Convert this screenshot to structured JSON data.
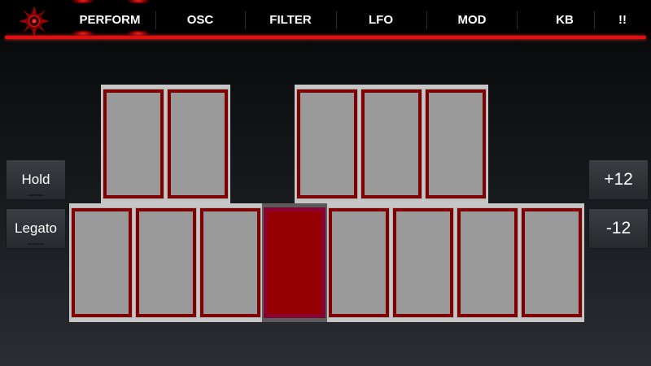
{
  "app": {
    "accent_color": "#e01010",
    "key_border_color": "#7e0000",
    "key_fill_color": "#9a9a9a",
    "pressed_key_color": "#950000"
  },
  "nav": {
    "logo_icon": "red-sun-logo-icon",
    "tabs": [
      {
        "label": "PERFORM",
        "selected": true
      },
      {
        "label": "OSC",
        "selected": false
      },
      {
        "label": "FILTER",
        "selected": false
      },
      {
        "label": "LFO",
        "selected": false
      },
      {
        "label": "MOD",
        "selected": false
      },
      {
        "label": "KB",
        "selected": false
      },
      {
        "label": "!!",
        "selected": false
      }
    ]
  },
  "left_controls": {
    "hold_label": "Hold",
    "legato_label": "Legato"
  },
  "right_controls": {
    "octave_up_label": "+12",
    "octave_down_label": "-12"
  },
  "keyboard": {
    "upper_left_keys": 2,
    "upper_right_keys": 3,
    "lower_keys": 8,
    "pressed_lower_key_index": 3
  }
}
